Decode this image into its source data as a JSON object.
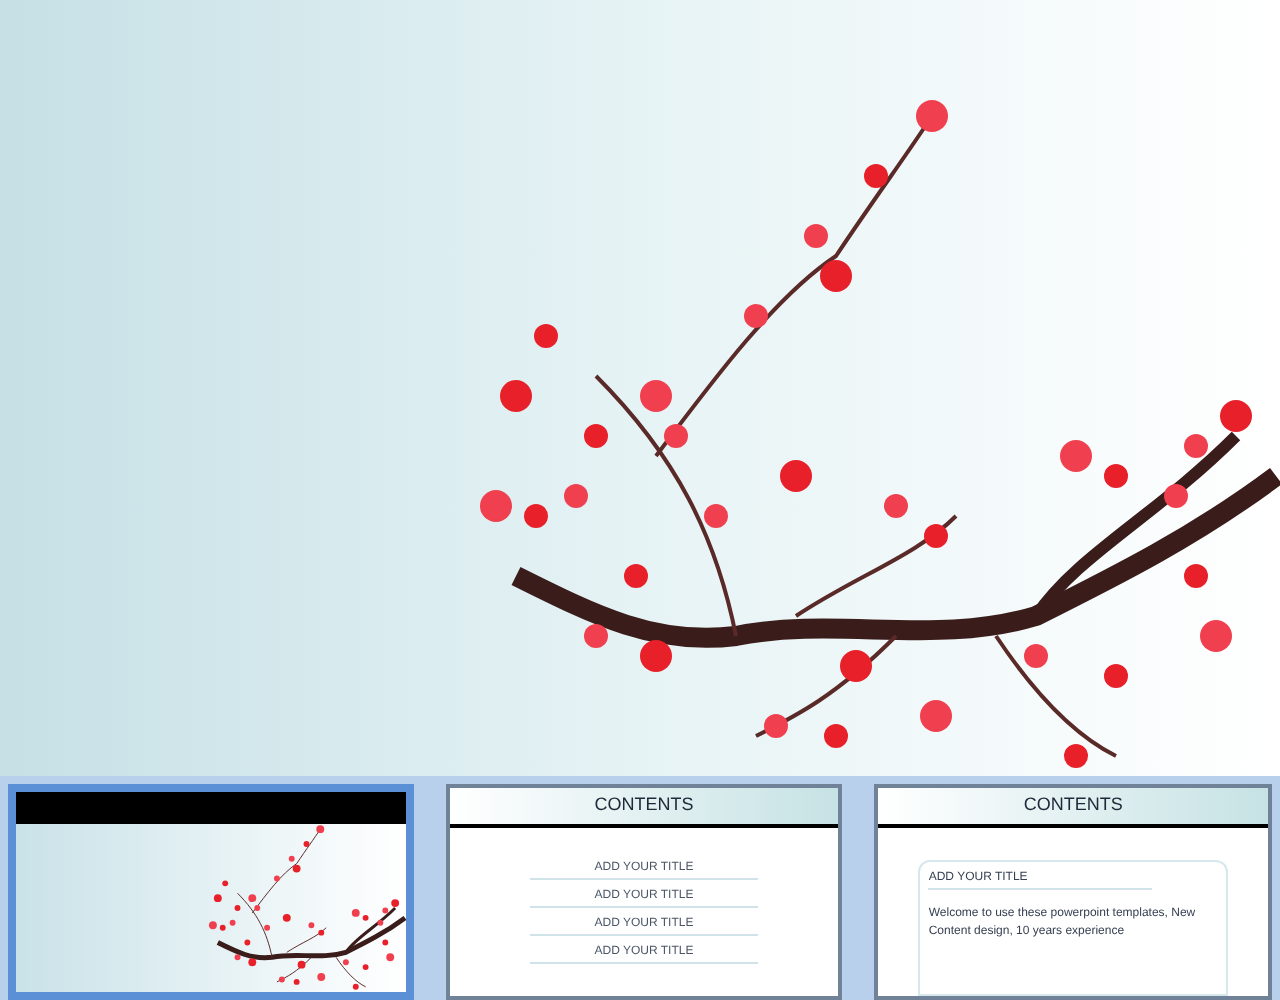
{
  "thumbnails": [
    {
      "kind": "cover",
      "selected": true
    },
    {
      "kind": "list",
      "selected": false,
      "title": "CONTENTS",
      "items": [
        "ADD YOUR TITLE",
        "ADD YOUR TITLE",
        "ADD YOUR TITLE",
        "ADD YOUR TITLE"
      ]
    },
    {
      "kind": "text",
      "selected": false,
      "title": "CONTENTS",
      "card_title": "ADD YOUR TITLE",
      "body": "Welcome to use these powerpoint templates, New Content design, 10 years experience"
    }
  ]
}
